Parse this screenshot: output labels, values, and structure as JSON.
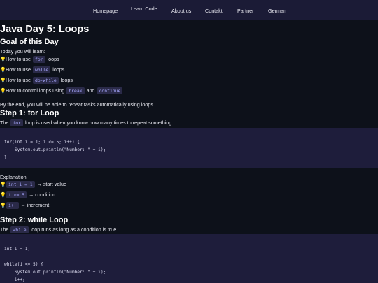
{
  "nav": {
    "items": [
      "Homepage",
      "Learn Code",
      "About us",
      "Contakt",
      "Partner",
      "German"
    ]
  },
  "page_title": "Java Day 5: Loops",
  "goal": {
    "heading": "Goal of this Day",
    "intro": "Today you will learn:",
    "items": [
      {
        "pre": "How to use",
        "code": "for",
        "post": "loops"
      },
      {
        "pre": "How to use",
        "code": "while",
        "post": "loops"
      },
      {
        "pre": "How to use",
        "code": "do-while",
        "post": "loops"
      },
      {
        "pre": "How to control loops using",
        "code": "break",
        "mid": "and",
        "code2": "continue"
      }
    ],
    "outro": "By the end, you will be able to repeat tasks automatically using loops."
  },
  "step1": {
    "heading": "Step 1: for Loop",
    "desc_pre": "The",
    "desc_code": "for",
    "desc_post": "loop is used when you know how many times to repeat something.",
    "code_lines": [
      "for(int i = 1; i <= 5; i++) {",
      "    System.out.println(\"Number: \" + i);",
      "}"
    ],
    "explanation_label": "Explanation:",
    "explanations": [
      {
        "code": "int i = 1",
        "text": "→ start value"
      },
      {
        "code": "i <= 5",
        "text": "→ condition"
      },
      {
        "code": "i++",
        "text": "→ increment"
      }
    ]
  },
  "step2": {
    "heading": "Step 2: while Loop",
    "desc_pre": "The",
    "desc_code": "while",
    "desc_post": "loop runs as long as a condition is true.",
    "code_lines": [
      "int i = 1;",
      "",
      "while(i <= 5) {",
      "    System.out.println(\"Number: \" + i);",
      "    i++;"
    ]
  },
  "icons": {
    "bulb": "💡"
  },
  "colors": {
    "nav_bg": "#1b1b36",
    "page_bg": "#0d111a",
    "code_bg": "#1e1d3b",
    "inline_code": "#a9a9ff"
  }
}
